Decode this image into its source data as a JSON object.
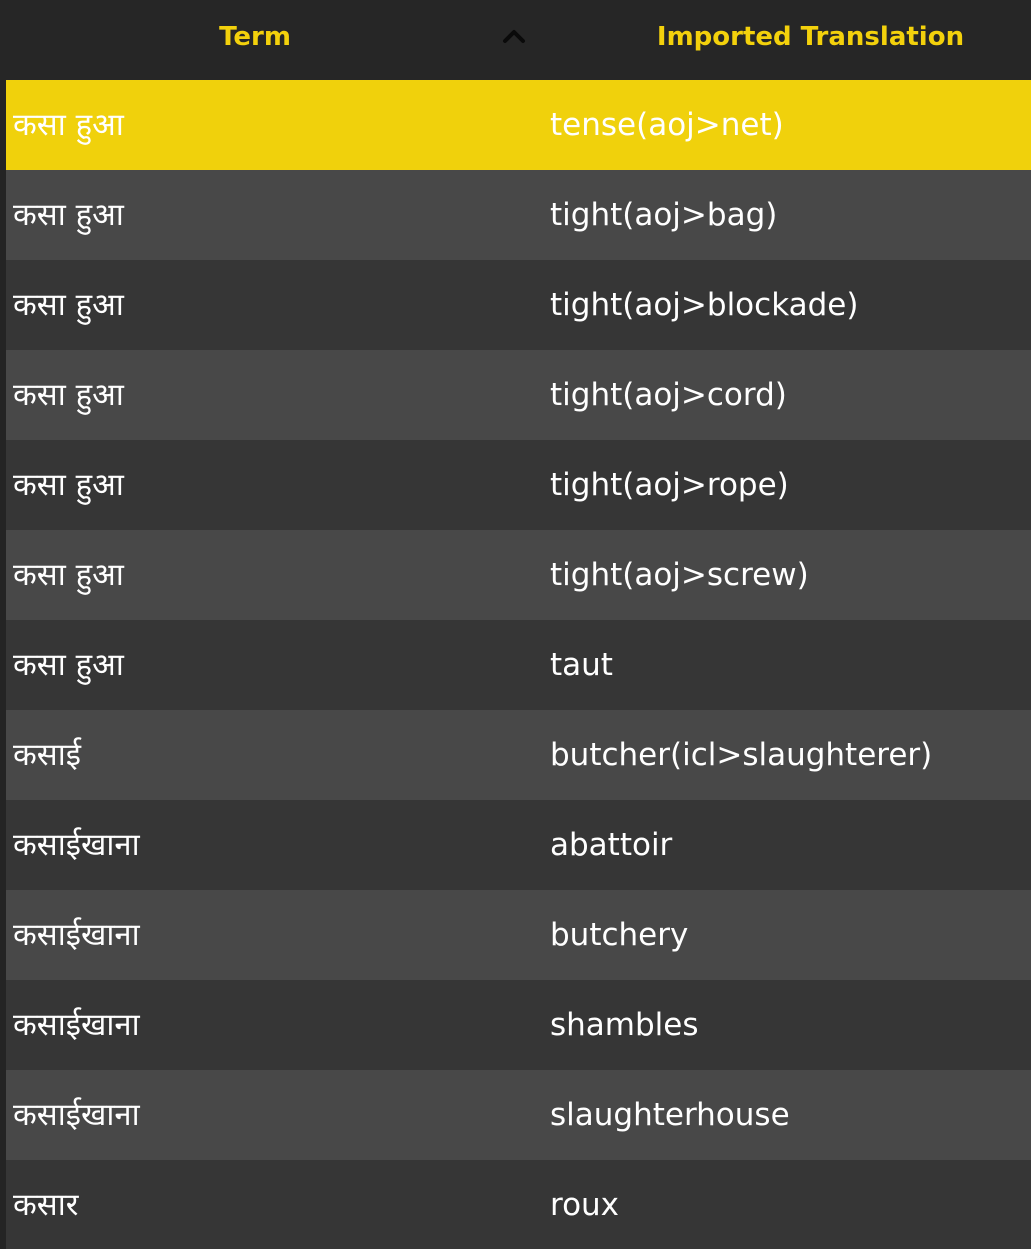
{
  "header": {
    "term_label": "Term",
    "translation_label": "Imported Translation",
    "sort_icon": "chevron-up-icon",
    "accent_color": "#f3d10c"
  },
  "colors": {
    "selected_row": "#f0d10c",
    "row_light": "#484848",
    "row_dark": "#363636",
    "header_bg": "#262626"
  },
  "rows": [
    {
      "term": "कसा हुआ",
      "translation": "tense(aoj>net)",
      "selected": true
    },
    {
      "term": "कसा हुआ",
      "translation": "tight(aoj>bag)"
    },
    {
      "term": "कसा हुआ",
      "translation": "tight(aoj>blockade)"
    },
    {
      "term": "कसा हुआ",
      "translation": "tight(aoj>cord)"
    },
    {
      "term": "कसा हुआ",
      "translation": "tight(aoj>rope)"
    },
    {
      "term": "कसा हुआ",
      "translation": "tight(aoj>screw)"
    },
    {
      "term": "कसा हुआ",
      "translation": "taut"
    },
    {
      "term": "कसाई",
      "translation": "butcher(icl>slaughterer)"
    },
    {
      "term": "कसाईखाना",
      "translation": "abattoir"
    },
    {
      "term": "कसाईखाना",
      "translation": "butchery"
    },
    {
      "term": "कसाईखाना",
      "translation": "shambles"
    },
    {
      "term": "कसाईखाना",
      "translation": "slaughterhouse"
    },
    {
      "term": "कसार",
      "translation": "roux"
    }
  ]
}
